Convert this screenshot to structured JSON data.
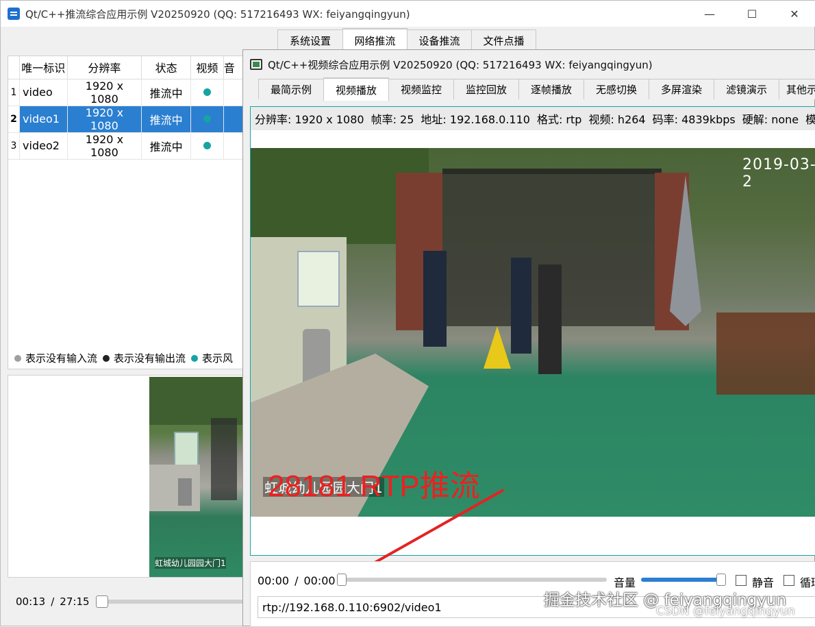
{
  "main_window": {
    "title": "Qt/C++推流综合应用示例 V20250920 (QQ: 517216493 WX: feiyangqingyun)",
    "controls": {
      "minimize": "—",
      "maximize": "☐",
      "close": "✕"
    },
    "tabs": [
      "系统设置",
      "网络推流",
      "设备推流",
      "文件点播"
    ],
    "active_tab": 1,
    "table": {
      "headers": [
        "唯一标识",
        "分辨率",
        "状态",
        "视频",
        "音"
      ],
      "rows": [
        {
          "num": "1",
          "id": "video",
          "res": "1920 x 1080",
          "status": "推流中"
        },
        {
          "num": "2",
          "id": "video1",
          "res": "1920 x 1080",
          "status": "推流中"
        },
        {
          "num": "3",
          "id": "video2",
          "res": "1920 x 1080",
          "status": "推流中"
        }
      ]
    },
    "legend": [
      "表示没有输入流",
      "表示没有输出流",
      "表示风"
    ],
    "legend_colors": [
      "#a0a0a0",
      "#222222",
      "#17a3a3"
    ],
    "preview_caption": "虹城幼儿园园大门1",
    "position": "00:13",
    "duration": "27:15",
    "time_sep": "/"
  },
  "video_window": {
    "title": "Qt/C++视频综合应用示例 V20250920 (QQ: 517216493 WX: feiyangqingyun)",
    "tabs": [
      "最简示例",
      "视频播放",
      "视频监控",
      "监控回放",
      "逐帧播放",
      "无感切换",
      "多屏渲染",
      "滤镜演示",
      "其他示"
    ],
    "active_tab": 1,
    "info": {
      "resolution": "分辨率: 1920 x 1080",
      "fps": "帧率: 25",
      "address": "地址: 192.168.0.110",
      "format": "格式: rtp",
      "video": "视频: h264",
      "bitrate": "码率: 4839kbps",
      "hwdec": "硬解: none",
      "mode": "模"
    },
    "osd_datetime": "2019-03-2",
    "osd_caption": "虹城幼儿园园大门1",
    "annotation": "28181 RTP推流",
    "player": {
      "position": "00:00",
      "duration": "00:00",
      "time_sep": "/",
      "volume_label": "音量",
      "volume": 0.96,
      "mute_label": "静音",
      "loop_label": "循环",
      "url": "rtp://192.168.0.110:6902/video1"
    }
  },
  "watermark": {
    "line1": "掘金技术社区 @ feiyangqingyun",
    "line2": "CSDN @feiyangqingyun"
  }
}
